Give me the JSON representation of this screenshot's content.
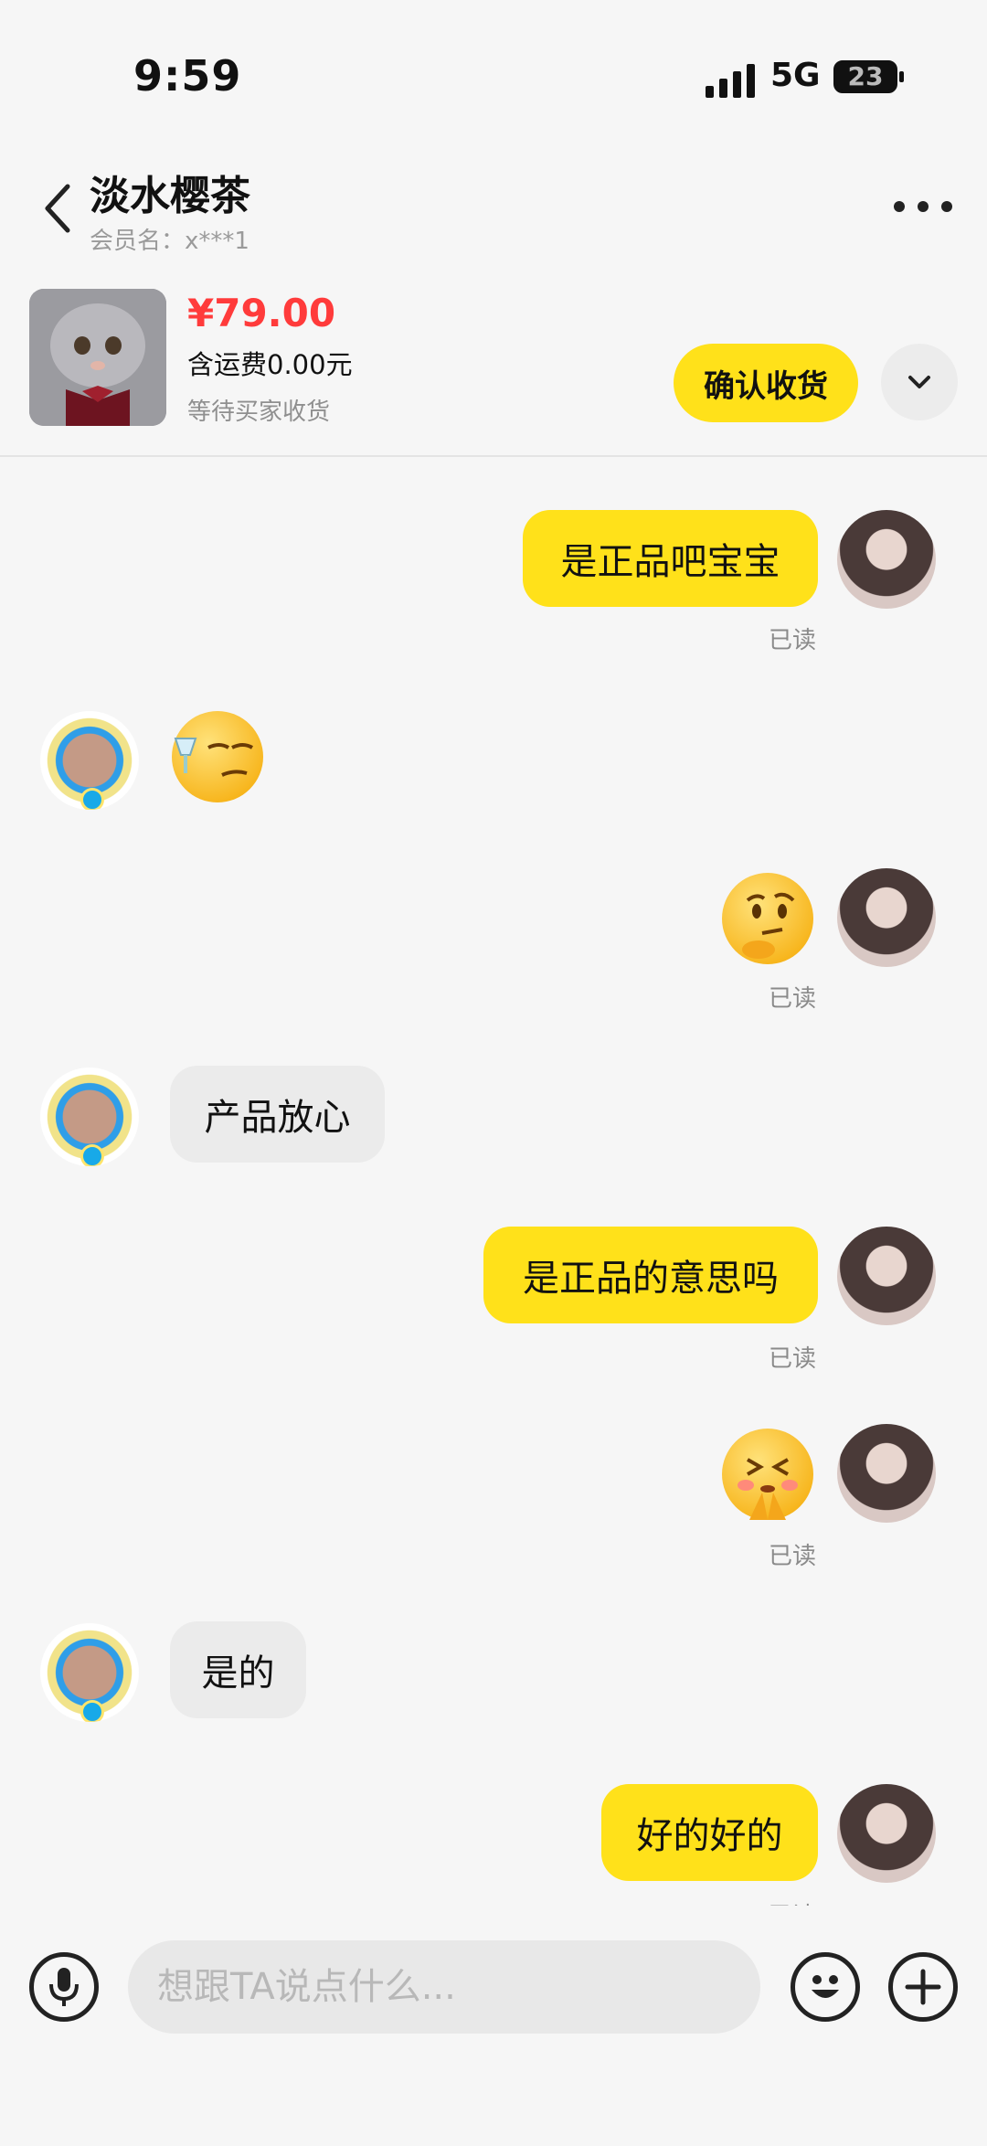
{
  "status_bar": {
    "time": "9:59",
    "network": "5G",
    "battery": "23"
  },
  "header": {
    "title": "淡水樱茶",
    "subtitle": "会员名：x***1"
  },
  "product": {
    "price": "¥79.00",
    "shipping": "含运费0.00元",
    "status": "等待买家收货",
    "confirm_label": "确认收货"
  },
  "messages": [
    {
      "text": "是正品吧宝宝",
      "read": "已读"
    },
    {
      "emoji": "smug-wine-emoji"
    },
    {
      "emoji": "thinking-emoji",
      "read": "已读"
    },
    {
      "text": "产品放心"
    },
    {
      "text": "是正品的意思吗",
      "read": "已读"
    },
    {
      "emoji": "pleading-emoji",
      "read": "已读"
    },
    {
      "text": "是的"
    },
    {
      "text": "好的好的",
      "read": "已读"
    }
  ],
  "input": {
    "placeholder": "想跟TA说点什么..."
  },
  "colors": {
    "accent": "#ffe11a",
    "price": "#ff3b3b",
    "background": "#f6f6f6"
  }
}
